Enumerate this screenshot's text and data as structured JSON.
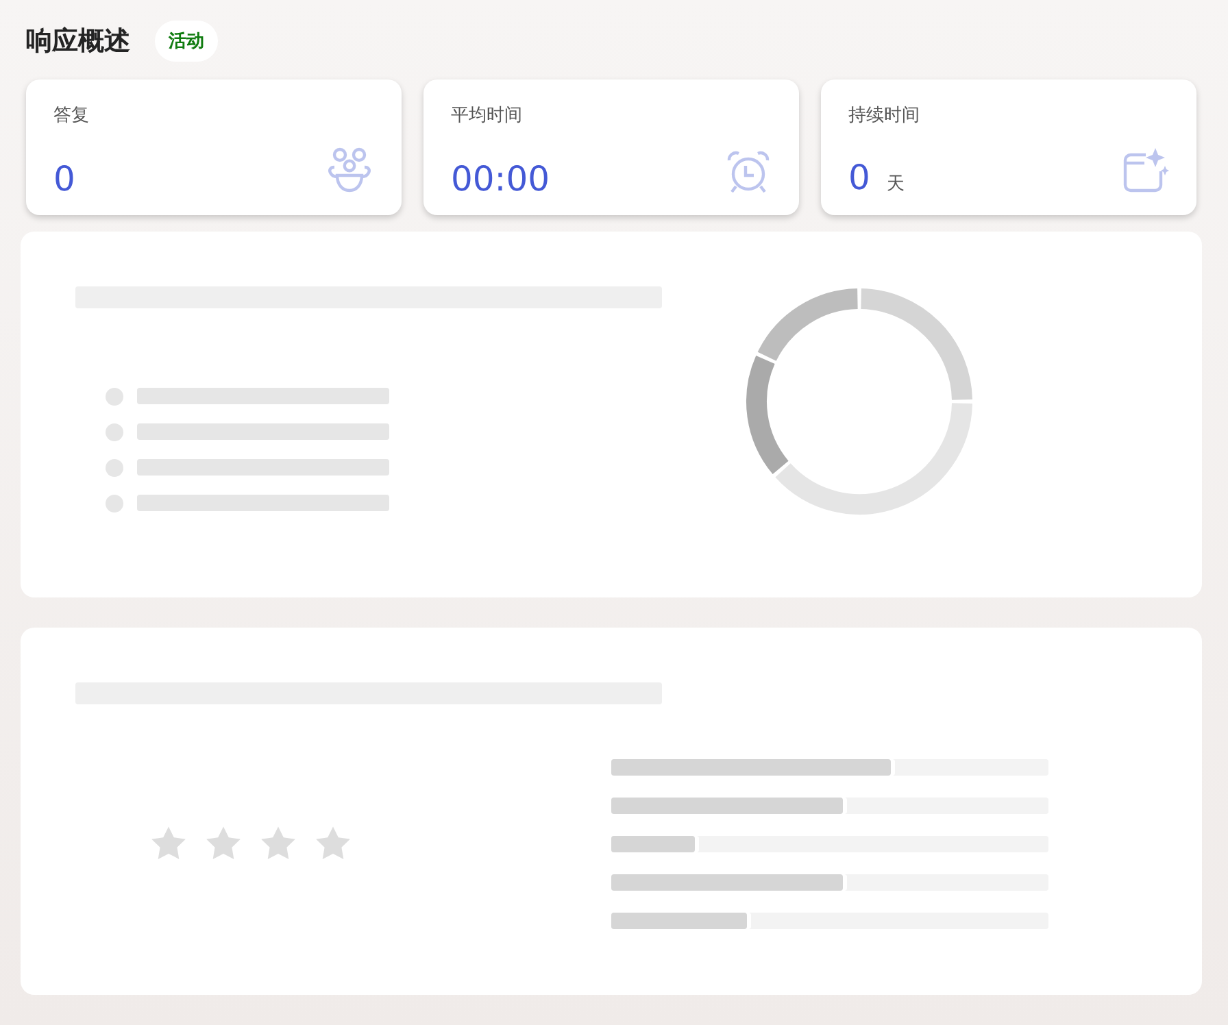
{
  "header": {
    "title": "响应概述",
    "badge": "活动"
  },
  "stats": [
    {
      "kind": "people",
      "label": "答复",
      "value": "0"
    },
    {
      "kind": "clock",
      "label": "平均时间",
      "value": "00:00"
    },
    {
      "kind": "calendar",
      "label": "持续时间",
      "value": "0",
      "unit": "天"
    }
  ],
  "rating_bars": [
    {
      "level": 0.64
    },
    {
      "level": 0.53
    },
    {
      "level": 0.19
    },
    {
      "level": 0.53
    },
    {
      "level": 0.31
    }
  ]
}
